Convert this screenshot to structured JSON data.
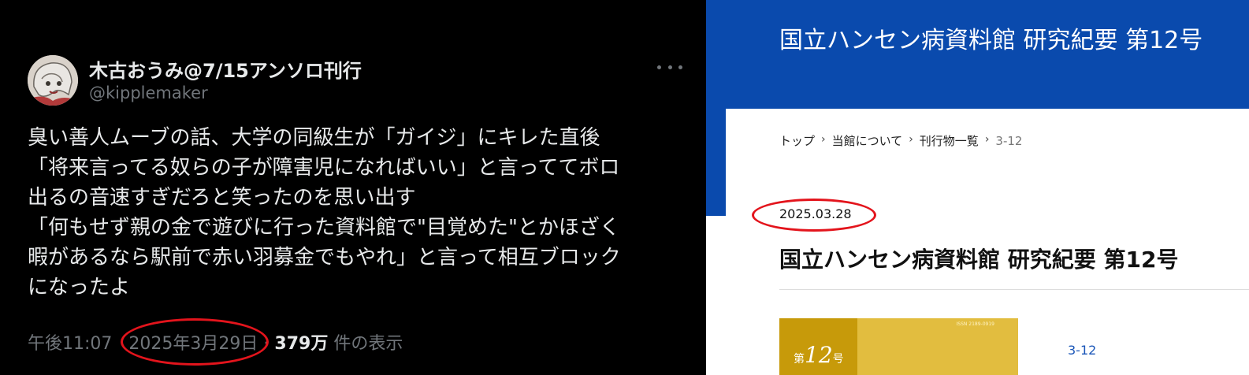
{
  "tweet": {
    "display_name": "木古おうみ@7/15アンソロ刊行",
    "handle": "@kipplemaker",
    "body_lines": [
      "臭い善人ムーブの話、大学の同級生が「ガイジ」にキレた直後",
      "「将来言ってる奴らの子が障害児になればいい」と言っててボロ",
      "出るの音速すぎだろと笑ったのを思い出す",
      "「何もせず親の金で遊びに行った資料館で\"目覚めた\"とかほざく",
      "暇があるなら駅前で赤い羽募金でもやれ」と言って相互ブロック",
      "になったよ"
    ],
    "time": "午後11:07",
    "date": "2025年3月29日",
    "separator": "·",
    "views_count": "379万",
    "views_label": "件の表示",
    "more_icon": "more-horizontal-icon"
  },
  "museum": {
    "banner_title": "国立ハンセン病資料館 研究紀要 第12号",
    "breadcrumbs": [
      {
        "label": "トップ"
      },
      {
        "label": "当館について"
      },
      {
        "label": "刊行物一覧"
      },
      {
        "label": "3-12"
      }
    ],
    "breadcrumb_separator": "›",
    "date": "2025.03.28",
    "title": "国立ハンセン病資料館 研究紀要 第12号",
    "cover": {
      "issue_prefix": "第",
      "issue_number": "12",
      "issue_suffix": "号",
      "issn": "ISSN 2189-0919"
    },
    "link": "3-12"
  },
  "colors": {
    "tweet_bg": "#000000",
    "museum_banner": "#0a4aad",
    "annotation_red": "#e3141c",
    "cover_gold": "#e2bd3f",
    "cover_band": "#c79a0a",
    "link_blue": "#1a56b8"
  }
}
